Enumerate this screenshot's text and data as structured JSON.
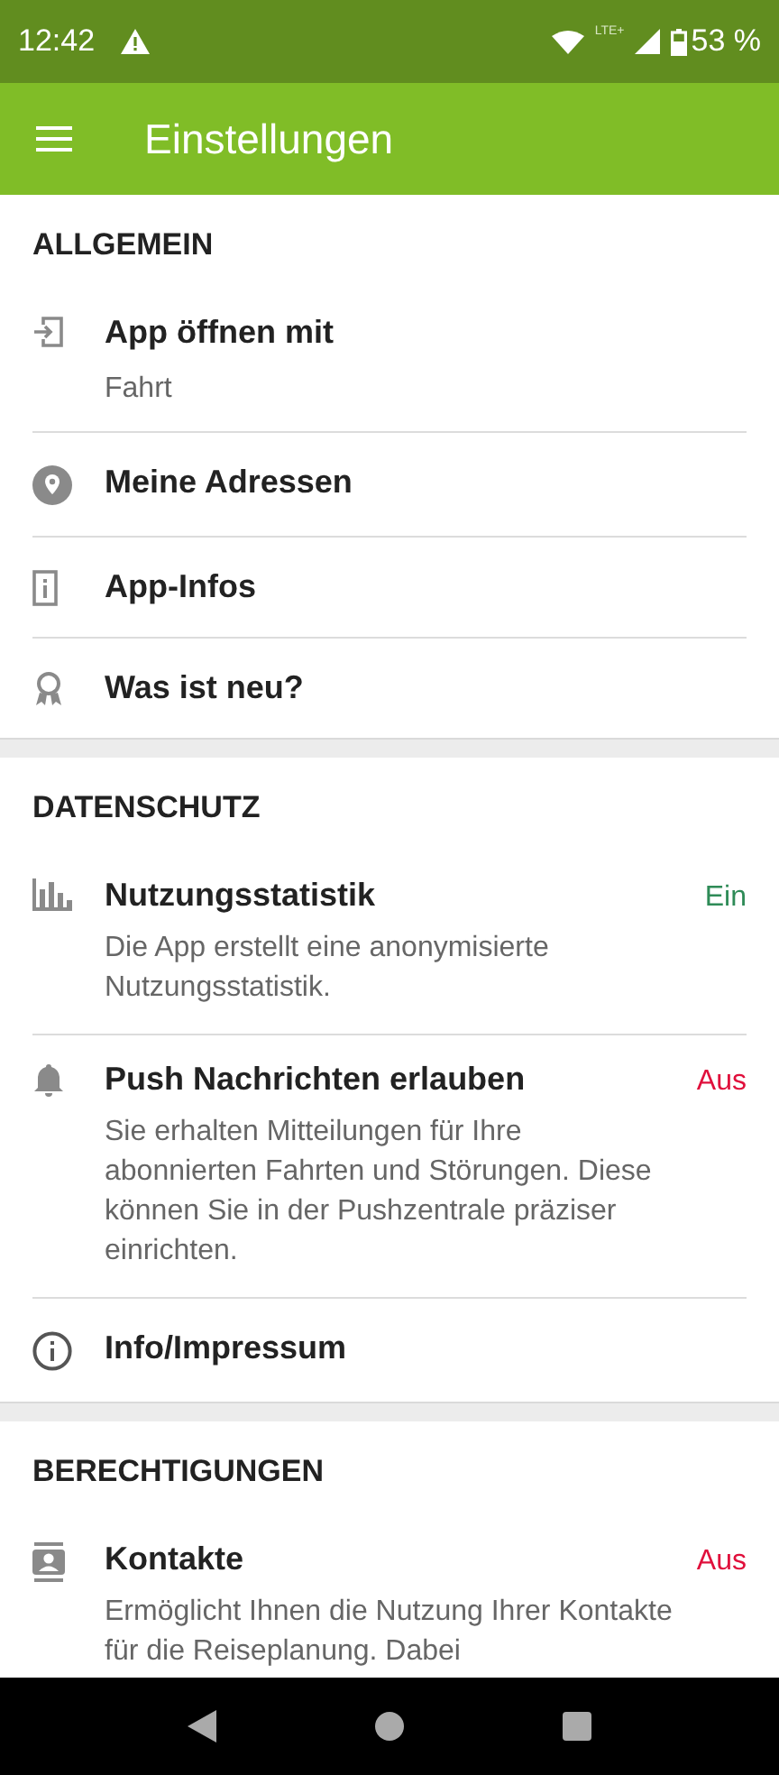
{
  "status_bar": {
    "time": "12:42",
    "network": "LTE+",
    "battery": "53 %"
  },
  "app_bar": {
    "title": "Einstellungen"
  },
  "sections": [
    {
      "title": "ALLGEMEIN",
      "items": [
        {
          "label": "App öffnen mit",
          "subtitle": "Fahrt"
        },
        {
          "label": "Meine Adressen"
        },
        {
          "label": "App-Infos"
        },
        {
          "label": "Was ist neu?"
        }
      ]
    },
    {
      "title": "DATENSCHUTZ",
      "items": [
        {
          "label": "Nutzungsstatistik",
          "description": "Die App erstellt eine anonymisierte Nutzungsstatistik.",
          "status": "Ein",
          "on": true
        },
        {
          "label": "Push Nachrichten erlauben",
          "description": "Sie erhalten Mitteilungen für Ihre abonnierten Fahrten und Störungen. Diese können Sie in der Pushzentrale präziser einrichten.",
          "status": "Aus",
          "on": false
        },
        {
          "label": "Info/Impressum"
        }
      ]
    },
    {
      "title": "BERECHTIGUNGEN",
      "items": [
        {
          "label": "Kontakte",
          "description": "Ermöglicht Ihnen die Nutzung Ihrer Kontakte für die Reiseplanung. Dabei",
          "status": "Aus",
          "on": false
        }
      ]
    }
  ]
}
